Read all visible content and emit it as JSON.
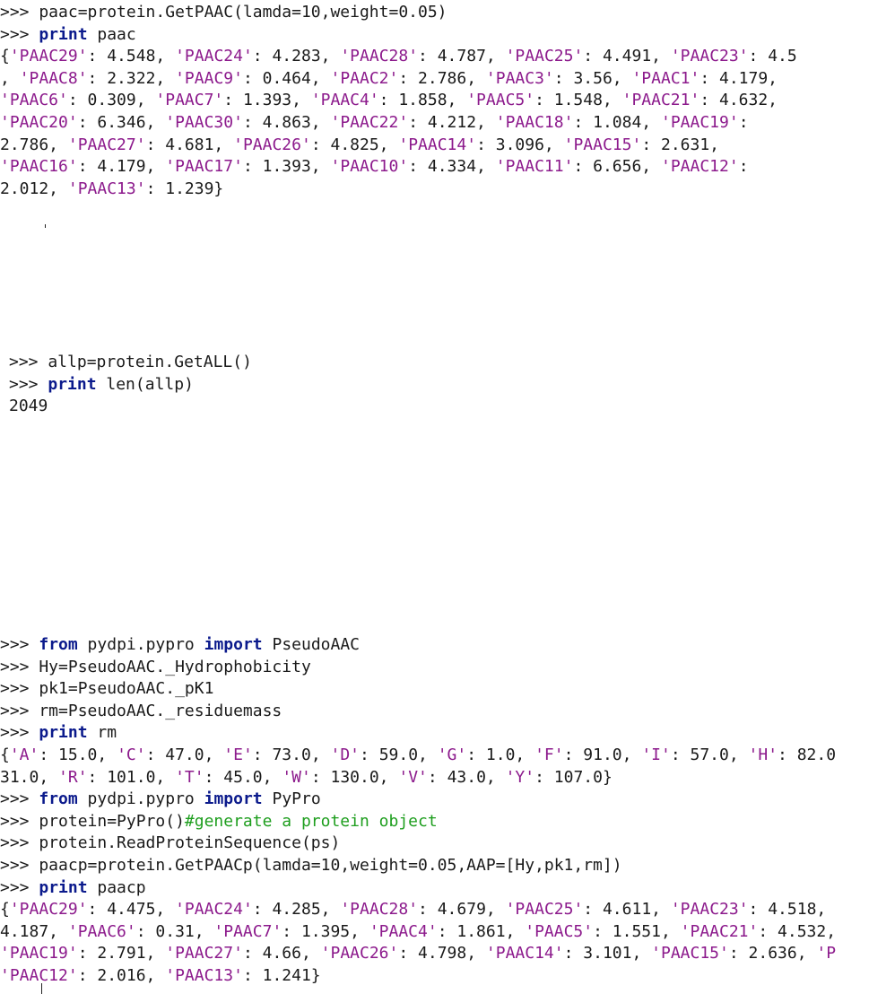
{
  "blocks": [
    {
      "id": "paac",
      "lines": [
        [
          {
            "t": ">>> paac=protein.GetPAAC(lamda=10,weight=0.05)"
          }
        ],
        [
          {
            "t": ">>> "
          },
          {
            "t": "print",
            "c": "kw"
          },
          {
            "t": " paac"
          }
        ],
        [
          {
            "t": "{"
          },
          {
            "t": "'PAAC29'",
            "c": "str"
          },
          {
            "t": ": 4.548, "
          },
          {
            "t": "'PAAC24'",
            "c": "str"
          },
          {
            "t": ": 4.283, "
          },
          {
            "t": "'PAAC28'",
            "c": "str"
          },
          {
            "t": ": 4.787, "
          },
          {
            "t": "'PAAC25'",
            "c": "str"
          },
          {
            "t": ": 4.491, "
          },
          {
            "t": "'PAAC23'",
            "c": "str"
          },
          {
            "t": ": 4.5"
          }
        ],
        [
          {
            "t": ", "
          },
          {
            "t": "'PAAC8'",
            "c": "str"
          },
          {
            "t": ": 2.322, "
          },
          {
            "t": "'PAAC9'",
            "c": "str"
          },
          {
            "t": ": 0.464, "
          },
          {
            "t": "'PAAC2'",
            "c": "str"
          },
          {
            "t": ": 2.786, "
          },
          {
            "t": "'PAAC3'",
            "c": "str"
          },
          {
            "t": ": 3.56, "
          },
          {
            "t": "'PAAC1'",
            "c": "str"
          },
          {
            "t": ": 4.179,"
          }
        ],
        [
          {
            "t": "'PAAC6'",
            "c": "str"
          },
          {
            "t": ": 0.309, "
          },
          {
            "t": "'PAAC7'",
            "c": "str"
          },
          {
            "t": ": 1.393, "
          },
          {
            "t": "'PAAC4'",
            "c": "str"
          },
          {
            "t": ": 1.858, "
          },
          {
            "t": "'PAAC5'",
            "c": "str"
          },
          {
            "t": ": 1.548, "
          },
          {
            "t": "'PAAC21'",
            "c": "str"
          },
          {
            "t": ": 4.632,"
          }
        ],
        [
          {
            "t": "'PAAC20'",
            "c": "str"
          },
          {
            "t": ": 6.346, "
          },
          {
            "t": "'PAAC30'",
            "c": "str"
          },
          {
            "t": ": 4.863, "
          },
          {
            "t": "'PAAC22'",
            "c": "str"
          },
          {
            "t": ": 4.212, "
          },
          {
            "t": "'PAAC18'",
            "c": "str"
          },
          {
            "t": ": 1.084, "
          },
          {
            "t": "'PAAC19'",
            "c": "str"
          },
          {
            "t": ":"
          }
        ],
        [
          {
            "t": "2.786, "
          },
          {
            "t": "'PAAC27'",
            "c": "str"
          },
          {
            "t": ": 4.681, "
          },
          {
            "t": "'PAAC26'",
            "c": "str"
          },
          {
            "t": ": 4.825, "
          },
          {
            "t": "'PAAC14'",
            "c": "str"
          },
          {
            "t": ": 3.096, "
          },
          {
            "t": "'PAAC15'",
            "c": "str"
          },
          {
            "t": ": 2.631,"
          }
        ],
        [
          {
            "t": "'PAAC16'",
            "c": "str"
          },
          {
            "t": ": 4.179, "
          },
          {
            "t": "'PAAC17'",
            "c": "str"
          },
          {
            "t": ": 1.393, "
          },
          {
            "t": "'PAAC10'",
            "c": "str"
          },
          {
            "t": ": 4.334, "
          },
          {
            "t": "'PAAC11'",
            "c": "str"
          },
          {
            "t": ": 6.656, "
          },
          {
            "t": "'PAAC12'",
            "c": "str"
          },
          {
            "t": ":"
          }
        ],
        [
          {
            "t": "2.012, "
          },
          {
            "t": "'PAAC13'",
            "c": "str"
          },
          {
            "t": ": 1.239}"
          }
        ]
      ]
    },
    {
      "id": "getall",
      "lines": [
        [
          {
            "t": ">>> allp=protein.GetALL()"
          }
        ],
        [
          {
            "t": ">>> "
          },
          {
            "t": "print",
            "c": "kw"
          },
          {
            "t": " len(allp)"
          }
        ],
        [
          {
            "t": "2049"
          }
        ]
      ]
    },
    {
      "id": "paacp",
      "lines": [
        [
          {
            "t": ">>> "
          },
          {
            "t": "from",
            "c": "kw"
          },
          {
            "t": " pydpi.pypro "
          },
          {
            "t": "import",
            "c": "kw"
          },
          {
            "t": " PseudoAAC"
          }
        ],
        [
          {
            "t": ">>> Hy=PseudoAAC._Hydrophobicity"
          }
        ],
        [
          {
            "t": ">>> pk1=PseudoAAC._pK1"
          }
        ],
        [
          {
            "t": ">>> rm=PseudoAAC._residuemass"
          }
        ],
        [
          {
            "t": ">>> "
          },
          {
            "t": "print",
            "c": "kw"
          },
          {
            "t": " rm"
          }
        ],
        [
          {
            "t": "{"
          },
          {
            "t": "'A'",
            "c": "str"
          },
          {
            "t": ": 15.0, "
          },
          {
            "t": "'C'",
            "c": "str"
          },
          {
            "t": ": 47.0, "
          },
          {
            "t": "'E'",
            "c": "str"
          },
          {
            "t": ": 73.0, "
          },
          {
            "t": "'D'",
            "c": "str"
          },
          {
            "t": ": 59.0, "
          },
          {
            "t": "'G'",
            "c": "str"
          },
          {
            "t": ": 1.0, "
          },
          {
            "t": "'F'",
            "c": "str"
          },
          {
            "t": ": 91.0, "
          },
          {
            "t": "'I'",
            "c": "str"
          },
          {
            "t": ": 57.0, "
          },
          {
            "t": "'H'",
            "c": "str"
          },
          {
            "t": ": 82.0"
          }
        ],
        [
          {
            "t": "31.0, "
          },
          {
            "t": "'R'",
            "c": "str"
          },
          {
            "t": ": 101.0, "
          },
          {
            "t": "'T'",
            "c": "str"
          },
          {
            "t": ": 45.0, "
          },
          {
            "t": "'W'",
            "c": "str"
          },
          {
            "t": ": 130.0, "
          },
          {
            "t": "'V'",
            "c": "str"
          },
          {
            "t": ": 43.0, "
          },
          {
            "t": "'Y'",
            "c": "str"
          },
          {
            "t": ": 107.0}"
          }
        ],
        [
          {
            "t": ">>> "
          },
          {
            "t": "from",
            "c": "kw"
          },
          {
            "t": " pydpi.pypro "
          },
          {
            "t": "import",
            "c": "kw"
          },
          {
            "t": " PyPro"
          }
        ],
        [
          {
            "t": ">>> protein=PyPro()"
          },
          {
            "t": "#generate a protein object",
            "c": "cmt"
          }
        ],
        [
          {
            "t": ">>> protein.ReadProteinSequence(ps)"
          }
        ],
        [
          {
            "t": ">>> paacp=protein.GetPAACp(lamda=10,weight=0.05,AAP=[Hy,pk1,rm])"
          }
        ],
        [
          {
            "t": ">>> "
          },
          {
            "t": "print",
            "c": "kw"
          },
          {
            "t": " paacp"
          }
        ],
        [
          {
            "t": "{"
          },
          {
            "t": "'PAAC29'",
            "c": "str"
          },
          {
            "t": ": 4.475, "
          },
          {
            "t": "'PAAC24'",
            "c": "str"
          },
          {
            "t": ": 4.285, "
          },
          {
            "t": "'PAAC28'",
            "c": "str"
          },
          {
            "t": ": 4.679, "
          },
          {
            "t": "'PAAC25'",
            "c": "str"
          },
          {
            "t": ": 4.611, "
          },
          {
            "t": "'PAAC23'",
            "c": "str"
          },
          {
            "t": ": 4.518,"
          }
        ],
        [
          {
            "t": "4.187, "
          },
          {
            "t": "'PAAC6'",
            "c": "str"
          },
          {
            "t": ": 0.31, "
          },
          {
            "t": "'PAAC7'",
            "c": "str"
          },
          {
            "t": ": 1.395, "
          },
          {
            "t": "'PAAC4'",
            "c": "str"
          },
          {
            "t": ": 1.861, "
          },
          {
            "t": "'PAAC5'",
            "c": "str"
          },
          {
            "t": ": 1.551, "
          },
          {
            "t": "'PAAC21'",
            "c": "str"
          },
          {
            "t": ": 4.532,"
          }
        ],
        [
          {
            "t": "'PAAC19'",
            "c": "str"
          },
          {
            "t": ": 2.791, "
          },
          {
            "t": "'PAAC27'",
            "c": "str"
          },
          {
            "t": ": 4.66, "
          },
          {
            "t": "'PAAC26'",
            "c": "str"
          },
          {
            "t": ": 4.798, "
          },
          {
            "t": "'PAAC14'",
            "c": "str"
          },
          {
            "t": ": 3.101, "
          },
          {
            "t": "'PAAC15'",
            "c": "str"
          },
          {
            "t": ": 2.636, "
          },
          {
            "t": "'P",
            "c": "str"
          }
        ],
        [
          {
            "t": "'PAAC12'",
            "c": "str"
          },
          {
            "t": ": 2.016, "
          },
          {
            "t": "'PAAC13'",
            "c": "str"
          },
          {
            "t": ": 1.241}"
          }
        ]
      ]
    }
  ]
}
